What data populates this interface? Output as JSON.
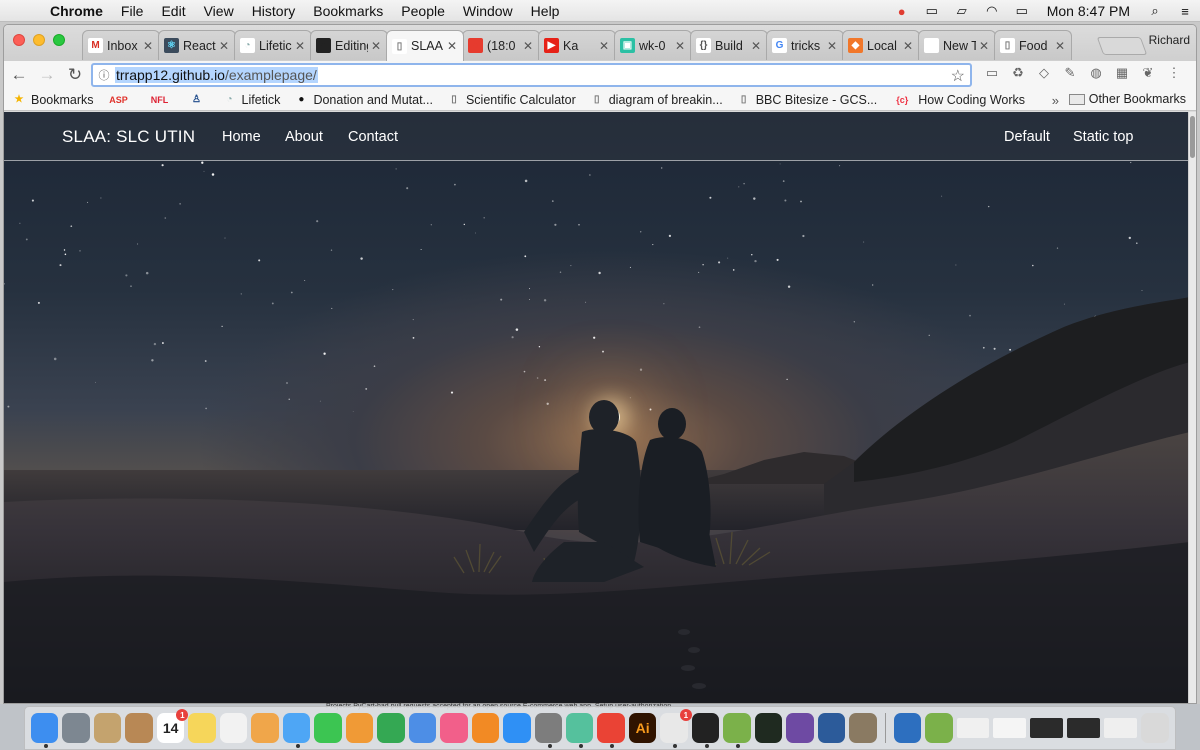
{
  "menubar": {
    "app": "Chrome",
    "items": [
      "File",
      "Edit",
      "View",
      "History",
      "Bookmarks",
      "People",
      "Window",
      "Help"
    ],
    "clock": "Mon 8:47 PM",
    "status_icons": [
      "adobe-cc-icon",
      "airplay-icon",
      "display-icon",
      "wifi-icon",
      "battery-icon",
      "search-icon",
      "list-icon"
    ]
  },
  "browser": {
    "profile": "Richard",
    "tabs": [
      {
        "title": "Inbox",
        "icon": "gmail-icon",
        "color": "#ffffff"
      },
      {
        "title": "React",
        "icon": "react-icon",
        "color": "#3b4b5c"
      },
      {
        "title": "Lifetick",
        "icon": "lifetick-icon",
        "color": "#ffffff"
      },
      {
        "title": "Editing",
        "icon": "github-icon",
        "color": "#222222"
      },
      {
        "title": "SLAA",
        "icon": "page-icon",
        "color": "#ffffff",
        "active": true
      },
      {
        "title": "(18:0",
        "icon": "tomato-icon",
        "color": "#e63b2e"
      },
      {
        "title": "Ka",
        "icon": "youtube-icon",
        "color": "#e62117"
      },
      {
        "title": "wk-0",
        "icon": "app-icon",
        "color": "#2bc0a4"
      },
      {
        "title": "Build",
        "icon": "braces-icon",
        "color": "#ffffff"
      },
      {
        "title": "tricks",
        "icon": "google-icon",
        "color": "#ffffff"
      },
      {
        "title": "Local",
        "icon": "pin-icon",
        "color": "#f1772a"
      },
      {
        "title": "New Tab",
        "icon": "none",
        "color": "#ffffff"
      },
      {
        "title": "Food",
        "icon": "page-icon",
        "color": "#ffffff"
      }
    ],
    "url_domain": "trrapp12.github.io",
    "url_path": "/examplepage/",
    "bookmarks": [
      {
        "label": "Bookmarks",
        "icon": "bookmark-star-icon"
      },
      {
        "label": "",
        "icon": "asp-icon"
      },
      {
        "label": "",
        "icon": "nfl-icon"
      },
      {
        "label": "",
        "icon": "person-icon"
      },
      {
        "label": "Lifetick",
        "icon": "lifetick-icon"
      },
      {
        "label": "Donation and Mutat...",
        "icon": "donation-icon"
      },
      {
        "label": "Scientific Calculator",
        "icon": "page-icon"
      },
      {
        "label": "diagram of breakin...",
        "icon": "page-icon"
      },
      {
        "label": "BBC Bitesize - GCS...",
        "icon": "page-icon"
      },
      {
        "label": "How Coding Works",
        "icon": "code-icon"
      }
    ],
    "other_bookmarks": "Other Bookmarks",
    "overflow": "»"
  },
  "site": {
    "brand": "SLAA:  SLC UTIN",
    "nav_left": [
      "Home",
      "About",
      "Contact"
    ],
    "nav_right": [
      "Default",
      "Static top"
    ]
  },
  "dock": {
    "apps": [
      {
        "name": "finder-icon",
        "color": "#3d8ef0"
      },
      {
        "name": "launchpad-icon",
        "color": "#7d8791"
      },
      {
        "name": "preview-icon",
        "color": "#c4a36e"
      },
      {
        "name": "contacts-icon",
        "color": "#b88855"
      },
      {
        "name": "calendar-icon",
        "color": "#ffffff",
        "text": "14"
      },
      {
        "name": "notes-icon",
        "color": "#f6d65a"
      },
      {
        "name": "reminders-icon",
        "color": "#f2f2f2"
      },
      {
        "name": "photos-icon",
        "color": "#f0a64a"
      },
      {
        "name": "messages-icon",
        "color": "#4ea6f5"
      },
      {
        "name": "facetime-icon",
        "color": "#3cc552"
      },
      {
        "name": "pages-icon",
        "color": "#f09a36"
      },
      {
        "name": "numbers-icon",
        "color": "#34a853"
      },
      {
        "name": "keynote-icon",
        "color": "#4d8ee6"
      },
      {
        "name": "itunes-icon",
        "color": "#f25f8a"
      },
      {
        "name": "ibooks-icon",
        "color": "#f28a24"
      },
      {
        "name": "app-store-icon",
        "color": "#2f90f5"
      },
      {
        "name": "system-preferences-icon",
        "color": "#7d7d7d"
      },
      {
        "name": "atom-icon",
        "color": "#55c19d"
      },
      {
        "name": "chrome-icon",
        "color": "#ea4335"
      },
      {
        "name": "illustrator-icon",
        "color": "#2f1300",
        "text": "Ai"
      },
      {
        "name": "slack-icon",
        "color": "#e8e8e8"
      },
      {
        "name": "terminal-icon",
        "color": "#222222"
      },
      {
        "name": "android-studio-icon",
        "color": "#7bb14a"
      },
      {
        "name": "activity-monitor-icon",
        "color": "#1f2a20"
      },
      {
        "name": "github-desktop-icon",
        "color": "#6e4aa3"
      },
      {
        "name": "quicktime-icon",
        "color": "#2c5b9a"
      },
      {
        "name": "gimp-icon",
        "color": "#8a7a62"
      },
      {
        "name": "xcode-icon",
        "color": "#2d6fbf"
      },
      {
        "name": "android-file-icon",
        "color": "#7bb14a"
      },
      {
        "name": "window-thumb-1",
        "color": "#f0f0f0"
      },
      {
        "name": "window-thumb-2",
        "color": "#f5f5f5"
      },
      {
        "name": "window-thumb-3",
        "color": "#2b2b2b"
      },
      {
        "name": "window-thumb-4",
        "color": "#2b2b2b"
      },
      {
        "name": "window-thumb-5",
        "color": "#efefef"
      },
      {
        "name": "trash-icon",
        "color": "#d9d9d9"
      }
    ],
    "calendar_badge": "1",
    "slack_badge": "1"
  },
  "behind_text": "Projects        PyCart-had pull requests accepted for an open source E-commerce web app.  Setup user-authorization"
}
